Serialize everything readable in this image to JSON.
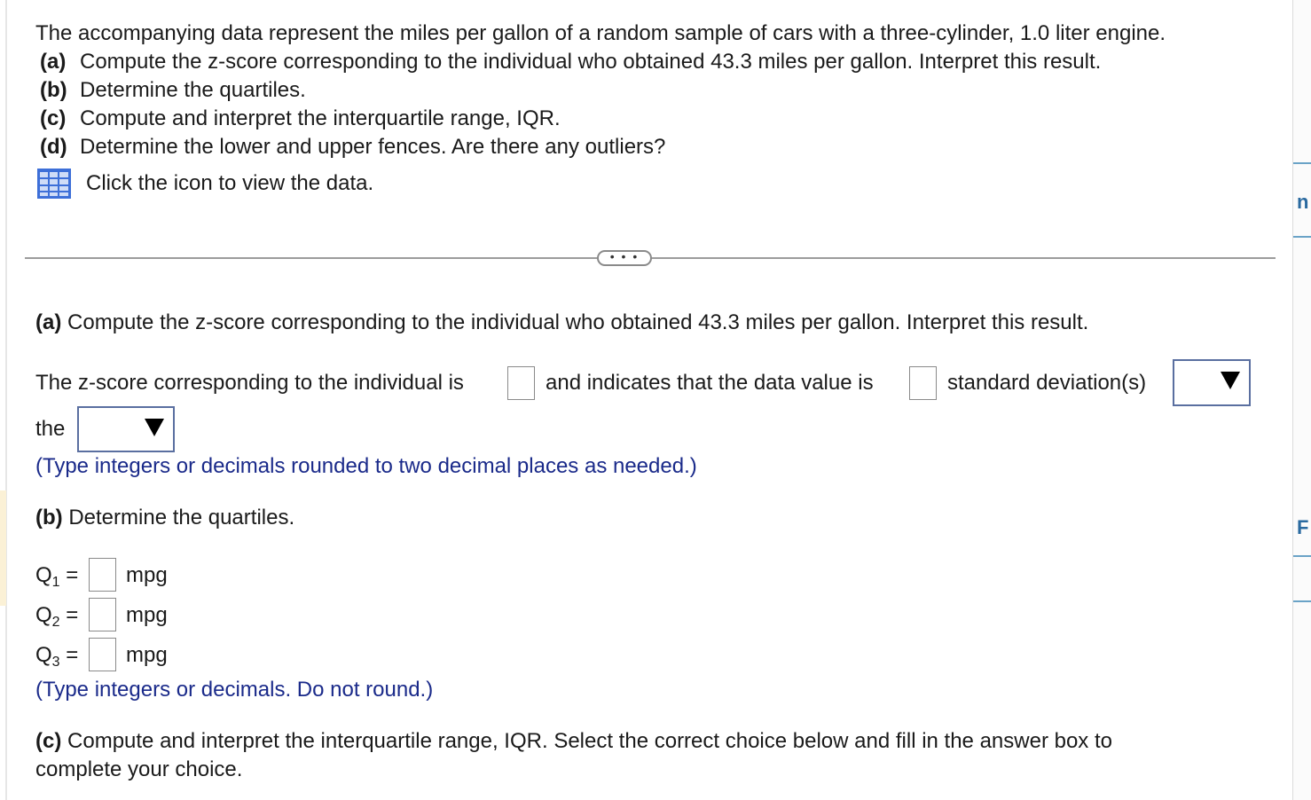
{
  "intro": {
    "stem": "The accompanying data represent the miles per gallon of a random sample of cars with a three-cylinder, 1.0 liter engine.",
    "parts": [
      {
        "label": "(a)",
        "text": "Compute the z-score corresponding to the individual who obtained 43.3 miles per gallon. Interpret this result."
      },
      {
        "label": "(b)",
        "text": "Determine the quartiles."
      },
      {
        "label": "(c)",
        "text": "Compute and interpret the interquartile range, IQR."
      },
      {
        "label": "(d)",
        "text": "Determine the lower and upper fences. Are there any outliers?"
      }
    ],
    "data_link": "Click the icon to view the data.",
    "data_icon": "data-table-icon"
  },
  "divider": {
    "more_label": "• • •"
  },
  "part_a": {
    "label": "(a)",
    "question": "Compute the z-score corresponding to the individual who obtained 43.3 miles per gallon. Interpret this result.",
    "s1": "The z-score corresponding to the individual is",
    "s2": "and indicates that the data value is",
    "s3": "standard deviation(s)",
    "s4": "the",
    "hint": "(Type integers or decimals rounded to two decimal places as needed.)",
    "zscore_value": "",
    "sd_value": "",
    "direction_selected": "",
    "mean_selected": ""
  },
  "part_b": {
    "label": "(b)",
    "question": "Determine the quartiles.",
    "rows": [
      {
        "q": "Q",
        "sub": "1",
        "eq": "=",
        "unit": "mpg",
        "value": ""
      },
      {
        "q": "Q",
        "sub": "2",
        "eq": "=",
        "unit": "mpg",
        "value": ""
      },
      {
        "q": "Q",
        "sub": "3",
        "eq": "=",
        "unit": "mpg",
        "value": ""
      }
    ],
    "hint": "(Type integers or decimals. Do not round.)"
  },
  "part_c": {
    "label": "(c)",
    "line1": "Compute and interpret the interquartile range, IQR. Select the correct choice below and fill in the answer box to",
    "line2": "complete your choice."
  },
  "colors": {
    "hint": "#1a2a8a",
    "select_border": "#5a6fa0",
    "icon_blue": "#3d6fd8"
  }
}
